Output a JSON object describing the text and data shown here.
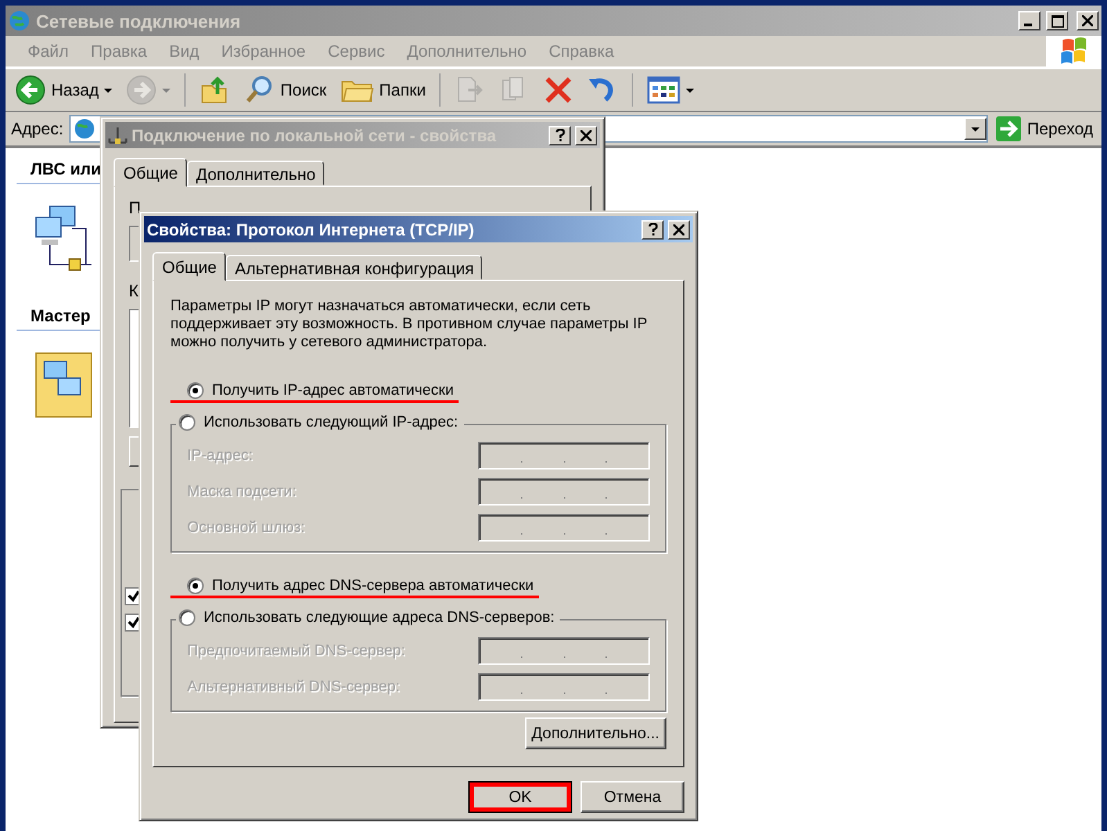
{
  "explorer": {
    "title": "Сетевые подключения",
    "menu": [
      "Файл",
      "Правка",
      "Вид",
      "Избранное",
      "Сервис",
      "Дополнительно",
      "Справка"
    ],
    "toolbar": [
      {
        "kind": "back",
        "label": "Назад",
        "dropdown": true
      },
      {
        "kind": "forward",
        "dropdown": true,
        "disabled": true
      },
      {
        "kind": "up"
      },
      {
        "kind": "search",
        "label": "Поиск"
      },
      {
        "kind": "folders",
        "label": "Папки"
      },
      {
        "kind": "move",
        "disabled": true
      },
      {
        "kind": "copy",
        "disabled": true
      },
      {
        "kind": "delete"
      },
      {
        "kind": "undo"
      },
      {
        "kind": "views",
        "dropdown": true
      }
    ],
    "address_label": "Адрес:",
    "go_label": "Переход",
    "sidebar": [
      {
        "title": "ЛВС или",
        "kind": "lan"
      },
      {
        "title": "Мастер",
        "kind": "wizard"
      }
    ]
  },
  "lan_dialog": {
    "title": "Подключение по локальной сети - свойства",
    "tabs": [
      {
        "label": "Общие",
        "selected": true
      },
      {
        "label": "Дополнительно",
        "selected": false
      }
    ],
    "partial_labels": [
      "П",
      "К"
    ],
    "checkboxes": [
      {
        "checked": true
      },
      {
        "checked": true
      }
    ]
  },
  "tcpip_dialog": {
    "title": "Свойства: Протокол Интернета (TCP/IP)",
    "tabs": [
      {
        "label": "Общие",
        "selected": true
      },
      {
        "label": "Альтернативная конфигурация",
        "selected": false
      }
    ],
    "description": "Параметры IP могут назначаться автоматически, если сеть поддерживает эту возможность. В противном случае параметры IP можно получить у сетевого администратора.",
    "sections": [
      {
        "auto": {
          "label": "Получить IP-адрес автоматически",
          "selected": true,
          "highlighted": true
        },
        "manual": {
          "label": "Использовать следующий IP-адрес:",
          "selected": false
        },
        "fields": [
          {
            "label": "IP-адрес:",
            "disabled": true
          },
          {
            "label": "Маска подсети:",
            "disabled": true
          },
          {
            "label": "Основной шлюз:",
            "disabled": true
          }
        ]
      },
      {
        "auto": {
          "label": "Получить адрес DNS-сервера автоматически",
          "selected": true,
          "highlighted": true
        },
        "manual": {
          "label": "Использовать следующие адреса DNS-серверов:",
          "selected": false
        },
        "fields": [
          {
            "label": "Предпочитаемый DNS-сервер:",
            "disabled": true
          },
          {
            "label": "Альтернативный DNS-сервер:",
            "disabled": true
          }
        ]
      }
    ],
    "advanced_button": "Дополнительно...",
    "buttons": [
      {
        "label": "OK",
        "highlighted": true
      },
      {
        "label": "Отмена",
        "highlighted": false
      }
    ]
  }
}
